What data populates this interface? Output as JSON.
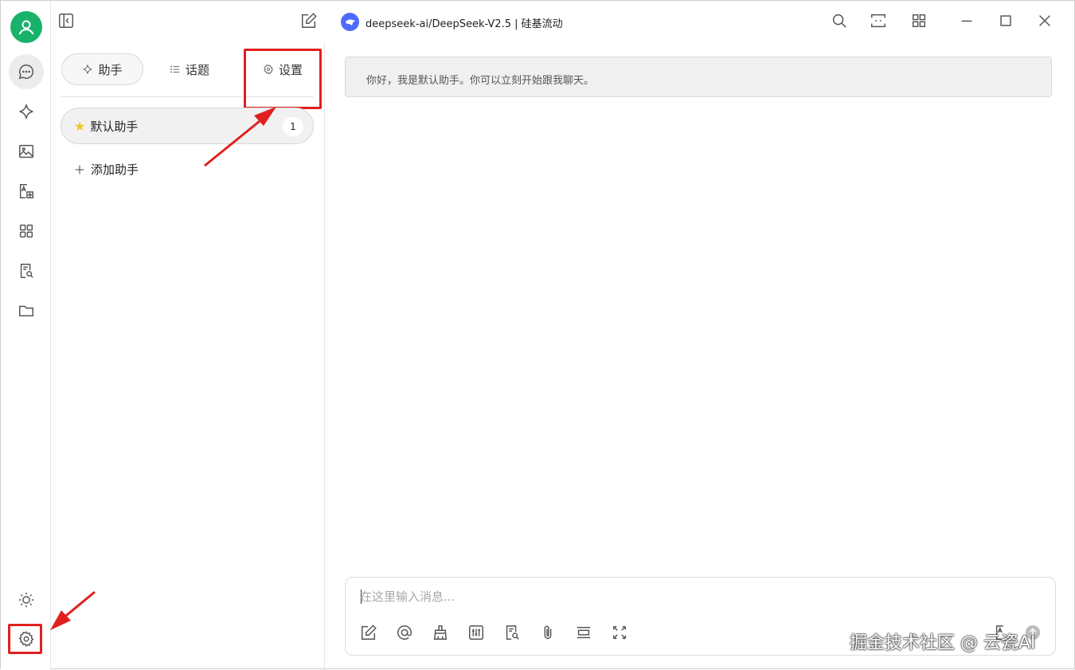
{
  "window": {
    "model_title": "deepseek-ai/DeepSeek-V2.5 | 硅基流动"
  },
  "rail": {
    "items": [
      {
        "name": "chat-icon"
      },
      {
        "name": "sparkle-icon"
      },
      {
        "name": "image-icon"
      },
      {
        "name": "translate-icon"
      },
      {
        "name": "apps-grid-icon"
      },
      {
        "name": "document-search-icon"
      },
      {
        "name": "folder-icon"
      }
    ],
    "bottom": [
      {
        "name": "sun-icon"
      },
      {
        "name": "gear-icon"
      }
    ]
  },
  "panel": {
    "tabs": [
      {
        "label": "助手",
        "icon": "sparkle-icon",
        "active": true
      },
      {
        "label": "话题",
        "icon": "list-icon",
        "active": false
      },
      {
        "label": "设置",
        "icon": "gear-icon",
        "active": false
      }
    ],
    "assistants": [
      {
        "label": "默认助手",
        "count": "1",
        "icon": "star-icon"
      }
    ],
    "add_label": "添加助手"
  },
  "chat": {
    "greeting": "你好，我是默认助手。你可以立刻开始跟我聊天。",
    "input_placeholder": "在这里输入消息..."
  },
  "toolbar": {
    "tools": [
      "edit-icon",
      "at-icon",
      "broom-icon",
      "sliders-icon",
      "doc-search-icon",
      "paperclip-icon",
      "divider-icon",
      "expand-icon"
    ]
  },
  "watermark": "掘金技术社区 @ 云瓷AI",
  "colors": {
    "accent_green": "#18b26a",
    "highlight_red": "#e02020",
    "deepseek_blue": "#4d6bfe"
  }
}
